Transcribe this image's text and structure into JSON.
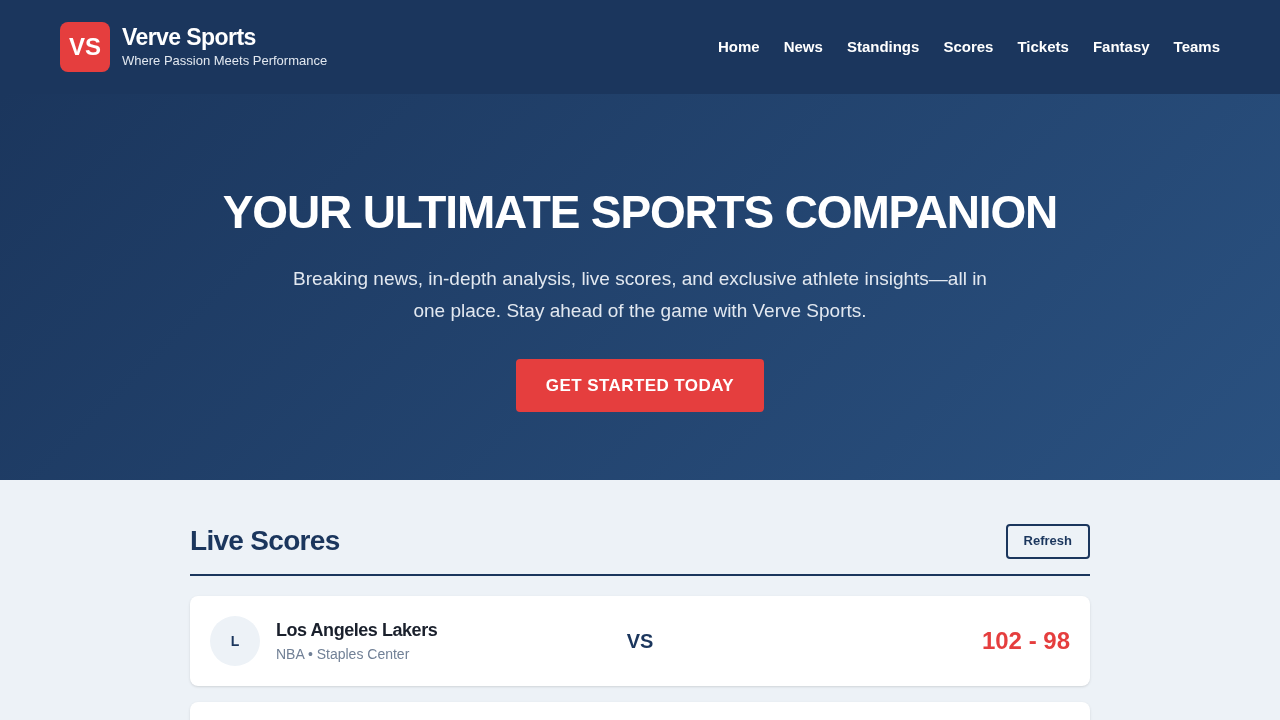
{
  "header": {
    "logo": "VS",
    "title": "Verve Sports",
    "tagline": "Where Passion Meets Performance",
    "nav": [
      "Home",
      "News",
      "Standings",
      "Scores",
      "Tickets",
      "Fantasy",
      "Teams"
    ]
  },
  "hero": {
    "title": "YOUR ULTIMATE SPORTS COMPANION",
    "text": "Breaking news, in-depth analysis, live scores, and exclusive athlete insights—all in one place. Stay ahead of the game with Verve Sports.",
    "button": "GET STARTED TODAY"
  },
  "live_scores": {
    "title": "Live Scores",
    "refresh": "Refresh",
    "games": [
      {
        "initial": "L",
        "team": "Los Angeles Lakers",
        "meta": "NBA • Staples Center",
        "vs": "VS",
        "score": "102 - 98"
      }
    ]
  }
}
